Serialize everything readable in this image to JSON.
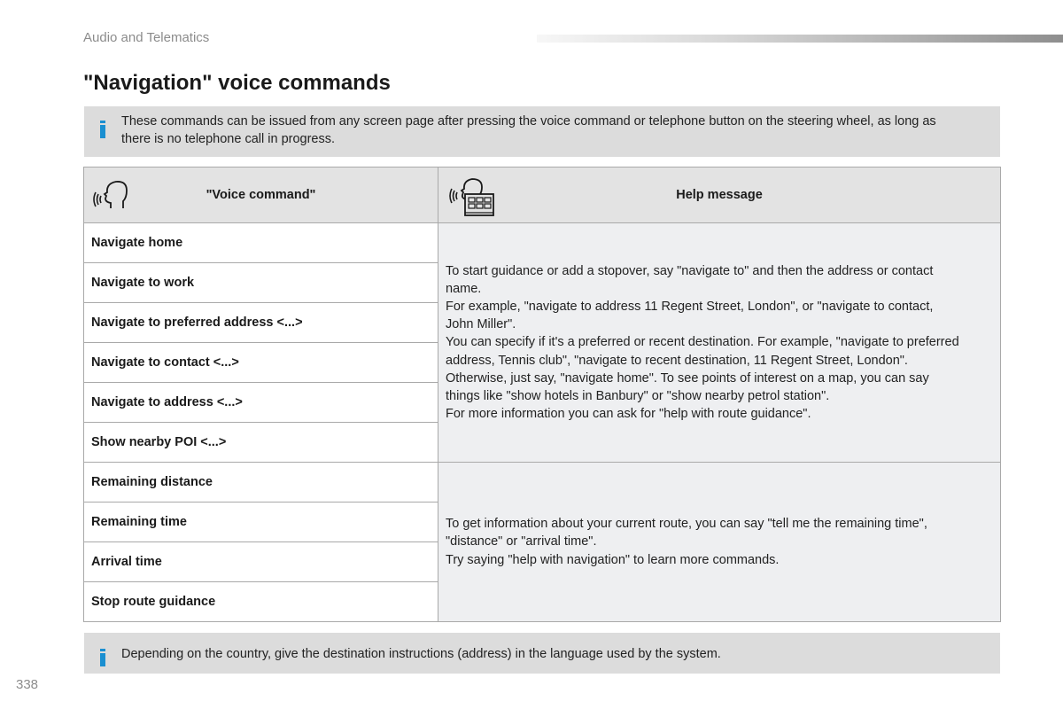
{
  "header": {
    "section": "Audio and Telematics",
    "title": "\"Navigation\" voice commands"
  },
  "info_top": {
    "icon": "info-icon",
    "lines": [
      "These commands can be issued from any screen page after pressing the voice command or telephone button on the steering wheel, as long as",
      "there is no telephone call in progress."
    ]
  },
  "table": {
    "columns": [
      {
        "label": "\"Voice command\"",
        "icon": "speaking-head-icon"
      },
      {
        "label": "Help message",
        "icon": "speaking-head-keypad-icon"
      }
    ],
    "groups": [
      {
        "commands": [
          "Navigate home",
          "Navigate to work",
          "Navigate to preferred address <...>",
          "Navigate to contact <...>",
          "Navigate to address <...>",
          "Show nearby POI <...>"
        ],
        "help": [
          "To start guidance or add a stopover, say \"navigate to\" and then the address or contact",
          "name.",
          "For example, \"navigate to address 11 Regent Street, London\", or \"navigate to contact,",
          "John Miller\".",
          "You can specify if it's a preferred or recent destination. For example, \"navigate to preferred",
          "address, Tennis club\", \"navigate to recent destination, 11 Regent Street, London\".",
          "Otherwise, just say, \"navigate home\". To see points of interest on a map, you can say",
          "things like \"show hotels in Banbury\" or \"show nearby petrol station\".",
          "For more information you can ask for \"help with route guidance\"."
        ]
      },
      {
        "commands": [
          "Remaining distance",
          "Remaining time",
          "Arrival time",
          "Stop route guidance"
        ],
        "help": [
          "To get information about your current route, you can say \"tell me the remaining time\",",
          "\"distance\" or \"arrival time\".",
          "Try saying \"help with navigation\" to learn more commands."
        ]
      }
    ]
  },
  "info_bottom": {
    "icon": "info-icon",
    "text": "Depending on the country, give the destination instructions (address) in the language used by the system."
  },
  "footer": {
    "page_number": "338"
  },
  "colors": {
    "info_accent": "#1a8fd1",
    "info_background": "#dcdcdc",
    "header_background": "#e3e3e3",
    "help_background": "#eeeff1"
  }
}
